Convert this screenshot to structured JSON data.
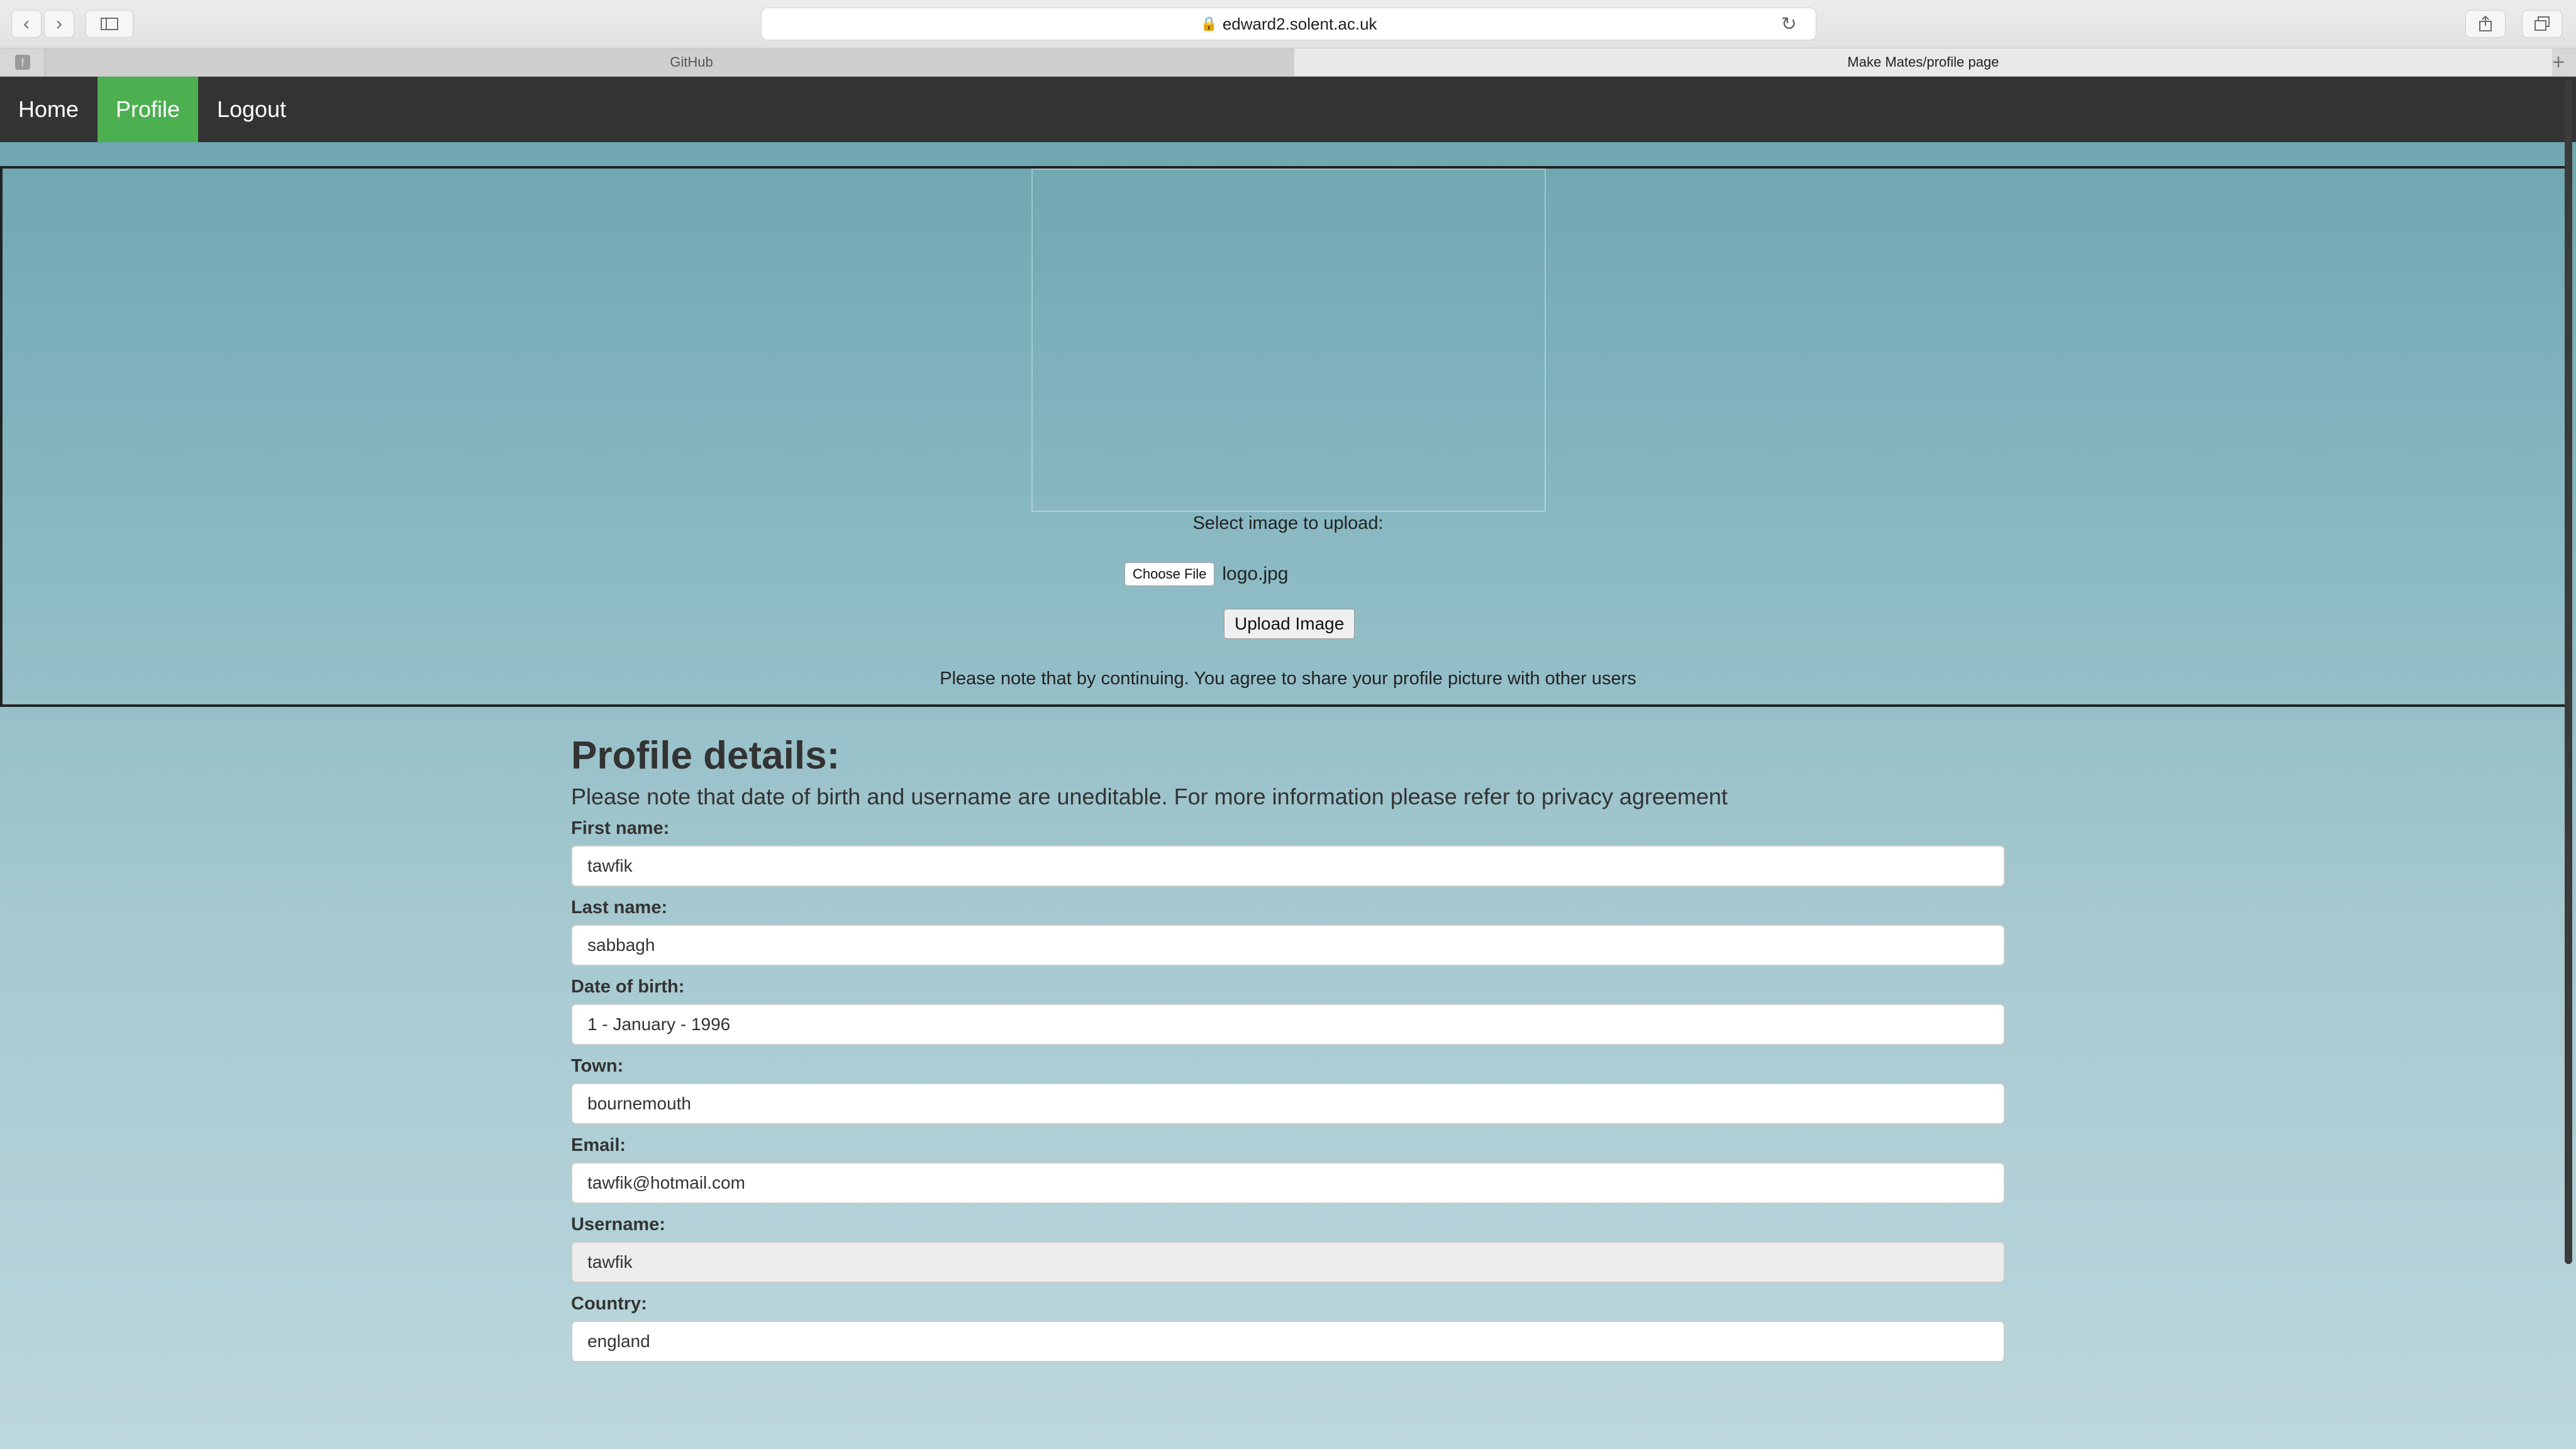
{
  "browser": {
    "url": "edward2.solent.ac.uk",
    "tabs": [
      {
        "label": "GitHub"
      },
      {
        "label": "Make Mates/profile page"
      }
    ]
  },
  "nav": {
    "home": "Home",
    "profile": "Profile",
    "logout": "Logout",
    "active_color": "#4caf50"
  },
  "upload": {
    "select_label": "Select image to upload:",
    "choose_file": "Choose File",
    "file_name": "logo.jpg",
    "upload_button": "Upload Image",
    "notice": "Please note that by continuing. You agree to share your profile picture with other users"
  },
  "profile": {
    "title": "Profile details:",
    "note": "Please note that date of birth and username are uneditable. For more information please refer to privacy agreement",
    "fields": [
      {
        "label": "First name:",
        "value": "tawfik"
      },
      {
        "label": "Last name:",
        "value": "sabbagh"
      },
      {
        "label": "Date of birth:",
        "value": "1 - January - 1996"
      },
      {
        "label": "Town:",
        "value": "bournemouth"
      },
      {
        "label": "Email:",
        "value": "tawfik@hotmail.com"
      },
      {
        "label": "Username:",
        "value": "tawfik"
      },
      {
        "label": "Country:",
        "value": "england"
      }
    ]
  }
}
